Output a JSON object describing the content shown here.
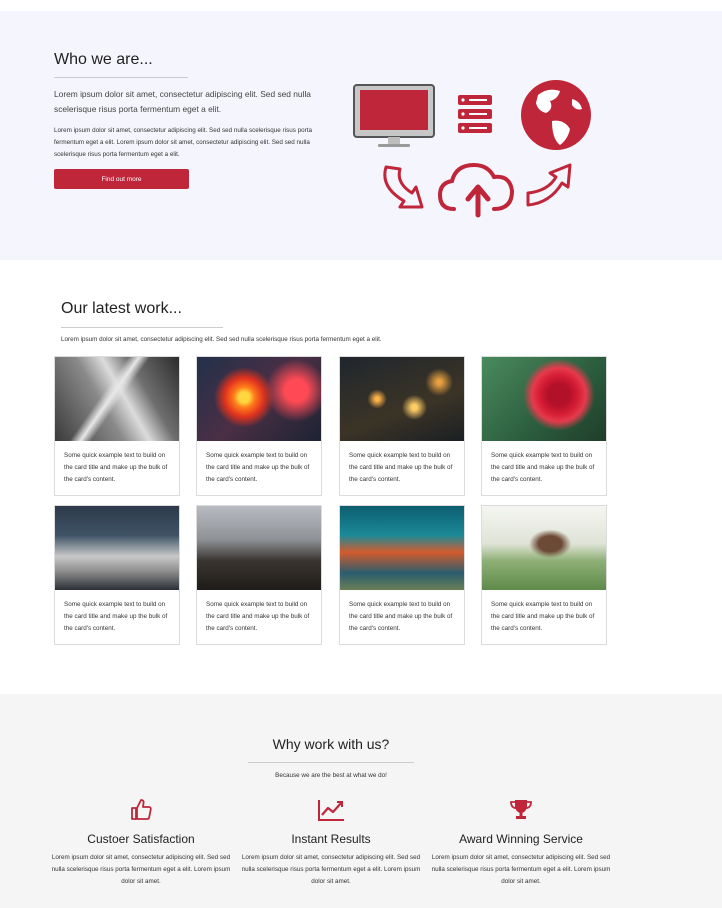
{
  "about": {
    "title": "Who we are...",
    "lead": "Lorem ipsum dolor sit amet, consectetur adipiscing elit. Sed sed nulla scelerisque risus porta fermentum eget a elit.",
    "body": "Lorem ipsum dolor sit amet, consectetur adipiscing elit. Sed sed nulla scelerisque risus porta fermentum eget a elit. Lorem ipsum dolor sit amet, consectetur adipiscing elit. Sed sed nulla scelerisque risus porta fermentum eget a elit.",
    "button_label": "Find out more",
    "graphic_icons": [
      "monitor-icon",
      "server-icon",
      "globe-icon",
      "curved-arrow-down-icon",
      "cloud-upload-icon",
      "curved-arrow-up-icon"
    ],
    "accent_color": "#c0263a"
  },
  "work": {
    "title": "Our latest work...",
    "lead": "Lorem ipsum dolor sit amet, consectetur adipiscing elit. Sed sed nulla scelerisque risus porta fermentum eget a elit.",
    "cards": [
      {
        "image": "skyscrapers-photo",
        "text": "Some quick example text to build on the card title and make up the bulk of the card's content."
      },
      {
        "image": "ferris-wheel-photo",
        "text": "Some quick example text to build on the card title and make up the bulk of the card's content."
      },
      {
        "image": "city-night-highway-photo",
        "text": "Some quick example text to build on the card title and make up the bulk of the card's content."
      },
      {
        "image": "red-rose-photo",
        "text": "Some quick example text to build on the card title and make up the bulk of the card's content."
      },
      {
        "image": "sneakers-skateboard-photo",
        "text": "Some quick example text to build on the card title and make up the bulk of the card's content."
      },
      {
        "image": "boardwalk-person-photo",
        "text": "Some quick example text to build on the card title and make up the bulk of the card's content."
      },
      {
        "image": "golden-gate-bridge-photo",
        "text": "Some quick example text to build on the card title and make up the bulk of the card's content."
      },
      {
        "image": "woman-flowers-photo",
        "text": "Some quick example text to build on the card title and make up the bulk of the card's content."
      }
    ]
  },
  "why": {
    "title": "Why work with us?",
    "tagline": "Because we are the best at what we do!",
    "features": [
      {
        "icon": "thumbs-up-icon",
        "title": "Custoer Satisfaction",
        "text": "Lorem ipsum dolor sit amet, consectetur adipiscing elit. Sed sed nulla scelerisque risus porta fermentum eget a elit. Lorem ipsum dolor sit amet."
      },
      {
        "icon": "line-chart-icon",
        "title": "Instant Results",
        "text": "Lorem ipsum dolor sit amet, consectetur adipiscing elit. Sed sed nulla scelerisque risus porta fermentum eget a elit. Lorem ipsum dolor sit amet."
      },
      {
        "icon": "trophy-icon",
        "title": "Award Winning Service",
        "text": "Lorem ipsum dolor sit amet, consectetur adipiscing elit. Sed sed nulla scelerisque risus porta fermentum eget a elit. Lorem ipsum dolor sit amet."
      }
    ]
  }
}
